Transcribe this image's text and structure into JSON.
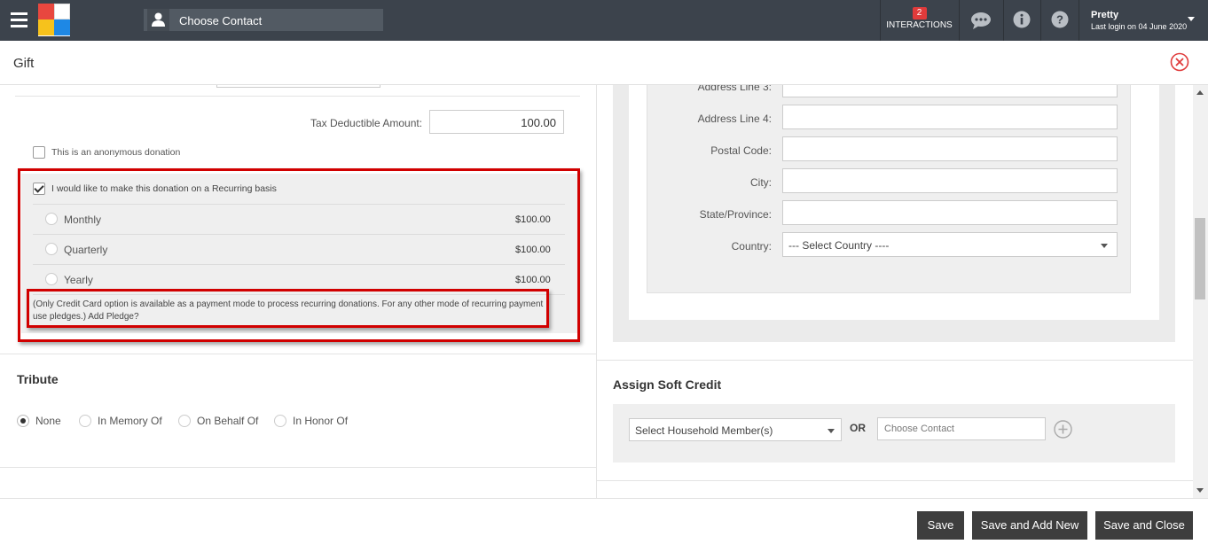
{
  "topbar": {
    "contact_search_label": "Choose Contact",
    "interactions_count": "2",
    "interactions_label": "INTERACTIONS",
    "user_name": "Pretty",
    "last_login": "Last login on 04 June 2020"
  },
  "dialog": {
    "title": "Gift"
  },
  "donation": {
    "tax_label": "Tax Deductible Amount:",
    "tax_value": "100.00",
    "anonymous_label": "This is an anonymous donation",
    "anonymous_checked": false,
    "recurring_label": "I would like to make this donation on a Recurring basis",
    "recurring_checked": true,
    "options": [
      {
        "label": "Monthly",
        "amount": "$100.00"
      },
      {
        "label": "Quarterly",
        "amount": "$100.00"
      },
      {
        "label": "Yearly",
        "amount": "$100.00"
      }
    ],
    "note": "(Only Credit Card option is available as a payment mode to process recurring donations. For any other mode of recurring payment use pledges.) Add Pledge?"
  },
  "tribute": {
    "title": "Tribute",
    "options": [
      "None",
      "In Memory Of",
      "On Behalf Of",
      "In Honor Of"
    ],
    "selected": "None"
  },
  "address": {
    "line3_label": "Address Line 3:",
    "line4_label": "Address Line 4:",
    "postal_label": "Postal Code:",
    "city_label": "City:",
    "state_label": "State/Province:",
    "country_label": "Country:",
    "country_value": "--- Select Country ----"
  },
  "soft_credit": {
    "title": "Assign Soft Credit",
    "household_value": "Select Household Member(s)",
    "or_label": "OR",
    "contact_placeholder": "Choose Contact"
  },
  "footer": {
    "save": "Save",
    "save_add_new": "Save and Add New",
    "save_close": "Save and Close"
  },
  "colors": {
    "topbar": "#3c434c",
    "highlight": "#d10000",
    "close_icon": "#e03b3b",
    "button": "#3e3e3e"
  }
}
